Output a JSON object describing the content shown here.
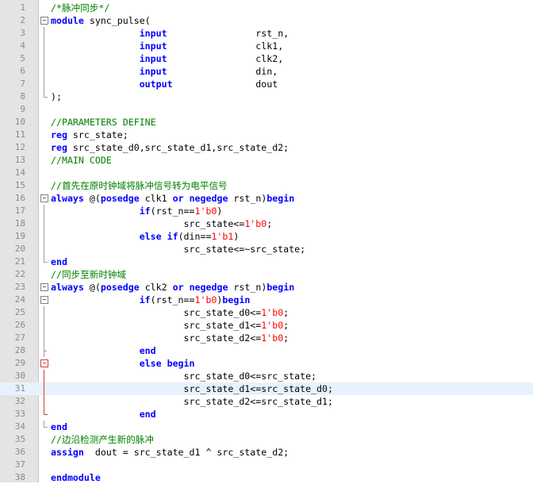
{
  "editor": {
    "lines": [
      {
        "num": "1",
        "fold": "",
        "parts": [
          {
            "t": "/*脉冲同步*/",
            "c": "cm"
          }
        ]
      },
      {
        "num": "2",
        "fold": "box",
        "parts": [
          {
            "t": "module",
            "c": "kw"
          },
          {
            "t": " sync_pulse(",
            "c": ""
          }
        ]
      },
      {
        "num": "3",
        "fold": "v",
        "parts": [
          {
            "t": "                ",
            "c": ""
          },
          {
            "t": "input",
            "c": "kw"
          },
          {
            "t": "                rst_n,",
            "c": ""
          }
        ]
      },
      {
        "num": "4",
        "fold": "v",
        "parts": [
          {
            "t": "                ",
            "c": ""
          },
          {
            "t": "input",
            "c": "kw"
          },
          {
            "t": "                clk1,",
            "c": ""
          }
        ]
      },
      {
        "num": "5",
        "fold": "v",
        "parts": [
          {
            "t": "                ",
            "c": ""
          },
          {
            "t": "input",
            "c": "kw"
          },
          {
            "t": "                clk2,",
            "c": ""
          }
        ]
      },
      {
        "num": "6",
        "fold": "v",
        "parts": [
          {
            "t": "                ",
            "c": ""
          },
          {
            "t": "input",
            "c": "kw"
          },
          {
            "t": "                din,",
            "c": ""
          }
        ]
      },
      {
        "num": "7",
        "fold": "v",
        "parts": [
          {
            "t": "                ",
            "c": ""
          },
          {
            "t": "output",
            "c": "kw"
          },
          {
            "t": "               dout",
            "c": ""
          }
        ]
      },
      {
        "num": "8",
        "fold": "end",
        "parts": [
          {
            "t": ");",
            "c": ""
          }
        ]
      },
      {
        "num": "9",
        "fold": "",
        "parts": []
      },
      {
        "num": "10",
        "fold": "",
        "parts": [
          {
            "t": "//PARAMETERS DEFINE",
            "c": "cm"
          }
        ]
      },
      {
        "num": "11",
        "fold": "",
        "parts": [
          {
            "t": "reg",
            "c": "kw"
          },
          {
            "t": " src_state;",
            "c": ""
          }
        ]
      },
      {
        "num": "12",
        "fold": "",
        "parts": [
          {
            "t": "reg",
            "c": "kw"
          },
          {
            "t": " src_state_d0,src_state_d1,src_state_d2;",
            "c": ""
          }
        ]
      },
      {
        "num": "13",
        "fold": "",
        "parts": [
          {
            "t": "//MAIN CODE",
            "c": "cm"
          }
        ]
      },
      {
        "num": "14",
        "fold": "",
        "parts": []
      },
      {
        "num": "15",
        "fold": "",
        "parts": [
          {
            "t": "//首先在原时钟域将脉冲信号转为电平信号",
            "c": "cm"
          }
        ]
      },
      {
        "num": "16",
        "fold": "box",
        "parts": [
          {
            "t": "always",
            "c": "kw"
          },
          {
            "t": " @(",
            "c": ""
          },
          {
            "t": "posedge",
            "c": "kw"
          },
          {
            "t": " clk1 ",
            "c": ""
          },
          {
            "t": "or",
            "c": "kw"
          },
          {
            "t": " ",
            "c": ""
          },
          {
            "t": "negedge",
            "c": "kw"
          },
          {
            "t": " rst_n)",
            "c": ""
          },
          {
            "t": "begin",
            "c": "kw"
          }
        ]
      },
      {
        "num": "17",
        "fold": "v",
        "parts": [
          {
            "t": "                ",
            "c": ""
          },
          {
            "t": "if",
            "c": "kw"
          },
          {
            "t": "(rst_n==",
            "c": ""
          },
          {
            "t": "1'b0",
            "c": "num"
          },
          {
            "t": ")",
            "c": ""
          }
        ]
      },
      {
        "num": "18",
        "fold": "v",
        "parts": [
          {
            "t": "                        src_state<=",
            "c": ""
          },
          {
            "t": "1'b0",
            "c": "num"
          },
          {
            "t": ";",
            "c": ""
          }
        ]
      },
      {
        "num": "19",
        "fold": "v",
        "parts": [
          {
            "t": "                ",
            "c": ""
          },
          {
            "t": "else",
            "c": "kw"
          },
          {
            "t": " ",
            "c": ""
          },
          {
            "t": "if",
            "c": "kw"
          },
          {
            "t": "(din==",
            "c": ""
          },
          {
            "t": "1'b1",
            "c": "num"
          },
          {
            "t": ")",
            "c": ""
          }
        ]
      },
      {
        "num": "20",
        "fold": "v",
        "parts": [
          {
            "t": "                        src_state<=~src_state;",
            "c": ""
          }
        ]
      },
      {
        "num": "21",
        "fold": "end",
        "parts": [
          {
            "t": "end",
            "c": "kw"
          }
        ]
      },
      {
        "num": "22",
        "fold": "",
        "parts": [
          {
            "t": "//同步至新时钟域",
            "c": "cm"
          }
        ]
      },
      {
        "num": "23",
        "fold": "box",
        "parts": [
          {
            "t": "always",
            "c": "kw"
          },
          {
            "t": " @(",
            "c": ""
          },
          {
            "t": "posedge",
            "c": "kw"
          },
          {
            "t": " clk2 ",
            "c": ""
          },
          {
            "t": "or",
            "c": "kw"
          },
          {
            "t": " ",
            "c": ""
          },
          {
            "t": "negedge",
            "c": "kw"
          },
          {
            "t": " rst_n)",
            "c": ""
          },
          {
            "t": "begin",
            "c": "kw"
          }
        ]
      },
      {
        "num": "24",
        "fold": "box",
        "parts": [
          {
            "t": "                ",
            "c": ""
          },
          {
            "t": "if",
            "c": "kw"
          },
          {
            "t": "(rst_n==",
            "c": ""
          },
          {
            "t": "1'b0",
            "c": "num"
          },
          {
            "t": ")",
            "c": ""
          },
          {
            "t": "begin",
            "c": "kw"
          }
        ]
      },
      {
        "num": "25",
        "fold": "v",
        "parts": [
          {
            "t": "                        src_state_d0<=",
            "c": ""
          },
          {
            "t": "1'b0",
            "c": "num"
          },
          {
            "t": ";",
            "c": ""
          }
        ]
      },
      {
        "num": "26",
        "fold": "v",
        "parts": [
          {
            "t": "                        src_state_d1<=",
            "c": ""
          },
          {
            "t": "1'b0",
            "c": "num"
          },
          {
            "t": ";",
            "c": ""
          }
        ]
      },
      {
        "num": "27",
        "fold": "v",
        "parts": [
          {
            "t": "                        src_state_d2<=",
            "c": ""
          },
          {
            "t": "1'b0",
            "c": "num"
          },
          {
            "t": ";",
            "c": ""
          }
        ]
      },
      {
        "num": "28",
        "fold": "tick",
        "parts": [
          {
            "t": "                ",
            "c": ""
          },
          {
            "t": "end",
            "c": "kw"
          }
        ]
      },
      {
        "num": "29",
        "fold": "boxred",
        "parts": [
          {
            "t": "                ",
            "c": ""
          },
          {
            "t": "else",
            "c": "kw"
          },
          {
            "t": " ",
            "c": ""
          },
          {
            "t": "begin",
            "c": "kw"
          }
        ]
      },
      {
        "num": "30",
        "fold": "vred",
        "parts": [
          {
            "t": "                        src_state_d0<=src_state;",
            "c": ""
          }
        ]
      },
      {
        "num": "31",
        "fold": "vred",
        "current": true,
        "parts": [
          {
            "t": "                        src_state_d1<=src_state_d0;",
            "c": ""
          }
        ]
      },
      {
        "num": "32",
        "fold": "vred",
        "parts": [
          {
            "t": "                        src_state_d2<=src_state_d1;",
            "c": ""
          }
        ]
      },
      {
        "num": "33",
        "fold": "endred",
        "parts": [
          {
            "t": "                ",
            "c": ""
          },
          {
            "t": "end",
            "c": "kw"
          }
        ]
      },
      {
        "num": "34",
        "fold": "end",
        "parts": [
          {
            "t": "end",
            "c": "kw"
          }
        ]
      },
      {
        "num": "35",
        "fold": "",
        "parts": [
          {
            "t": "//边沿检测产生新的脉冲",
            "c": "cm"
          }
        ]
      },
      {
        "num": "36",
        "fold": "",
        "parts": [
          {
            "t": "assign",
            "c": "kw"
          },
          {
            "t": "  dout = src_state_d1 ^ src_state_d2;",
            "c": ""
          }
        ]
      },
      {
        "num": "37",
        "fold": "",
        "parts": []
      },
      {
        "num": "38",
        "fold": "",
        "parts": [
          {
            "t": "endmodule",
            "c": "kw"
          }
        ]
      }
    ]
  }
}
